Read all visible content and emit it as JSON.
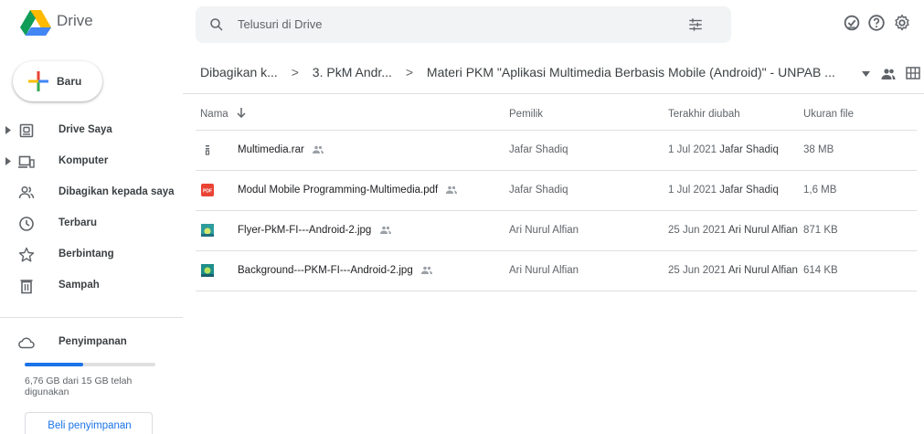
{
  "header": {
    "app_name": "Drive",
    "search_placeholder": "Telusuri di Drive",
    "icons": [
      "drive-logo",
      "search-icon",
      "tune-icon",
      "offline-ready-icon",
      "help-icon",
      "settings-icon"
    ]
  },
  "sidebar": {
    "new_label": "Baru",
    "items": [
      {
        "label": "Drive Saya",
        "icon": "my-drive-icon",
        "expandable": true
      },
      {
        "label": "Komputer",
        "icon": "computer-icon",
        "expandable": true
      },
      {
        "label": "Dibagikan kepada saya",
        "icon": "shared-with-me-icon",
        "expandable": false
      },
      {
        "label": "Terbaru",
        "icon": "clock-icon",
        "expandable": false
      },
      {
        "label": "Berbintang",
        "icon": "star-icon",
        "expandable": false
      },
      {
        "label": "Sampah",
        "icon": "trash-icon",
        "expandable": false
      }
    ],
    "storage": {
      "label": "Penyimpanan",
      "usage_text": "6,76 GB dari 15 GB telah digunakan",
      "used_fraction": 0.45,
      "buy_label": "Beli penyimpanan"
    }
  },
  "breadcrumb": {
    "items": [
      "Dibagikan k...",
      "3. PkM Andr...",
      "Materi PKM \"Aplikasi Multimedia Berbasis Mobile (Android)\" - UNPAB ..."
    ],
    "separator": ">"
  },
  "table": {
    "columns": {
      "name": "Nama",
      "owner": "Pemilik",
      "modified": "Terakhir diubah",
      "size": "Ukuran file"
    },
    "rows": [
      {
        "name": "Multimedia.rar",
        "type": "archive",
        "owner": "Jafar Shadiq",
        "modified_date": "1 Jul 2021",
        "modified_by": "Jafar Shadiq",
        "size": "38 MB"
      },
      {
        "name": "Modul Mobile Programming-Multimedia.pdf",
        "type": "pdf",
        "owner": "Jafar Shadiq",
        "modified_date": "1 Jul 2021",
        "modified_by": "Jafar Shadiq",
        "size": "1,6 MB"
      },
      {
        "name": "Flyer-PkM-FI---Android-2.jpg",
        "type": "image",
        "owner": "Ari Nurul Alfian",
        "modified_date": "25 Jun 2021",
        "modified_by": "Ari Nurul Alfian",
        "size": "871 KB"
      },
      {
        "name": "Background---PKM-FI---Android-2.jpg",
        "type": "image",
        "owner": "Ari Nurul Alfian",
        "modified_date": "25 Jun 2021",
        "modified_by": "Ari Nurul Alfian",
        "size": "614 KB"
      }
    ]
  },
  "colors": {
    "accent": "#1a73e8",
    "pdf_red": "#ea4335",
    "text": "#3c4043",
    "muted": "#5f6368"
  }
}
